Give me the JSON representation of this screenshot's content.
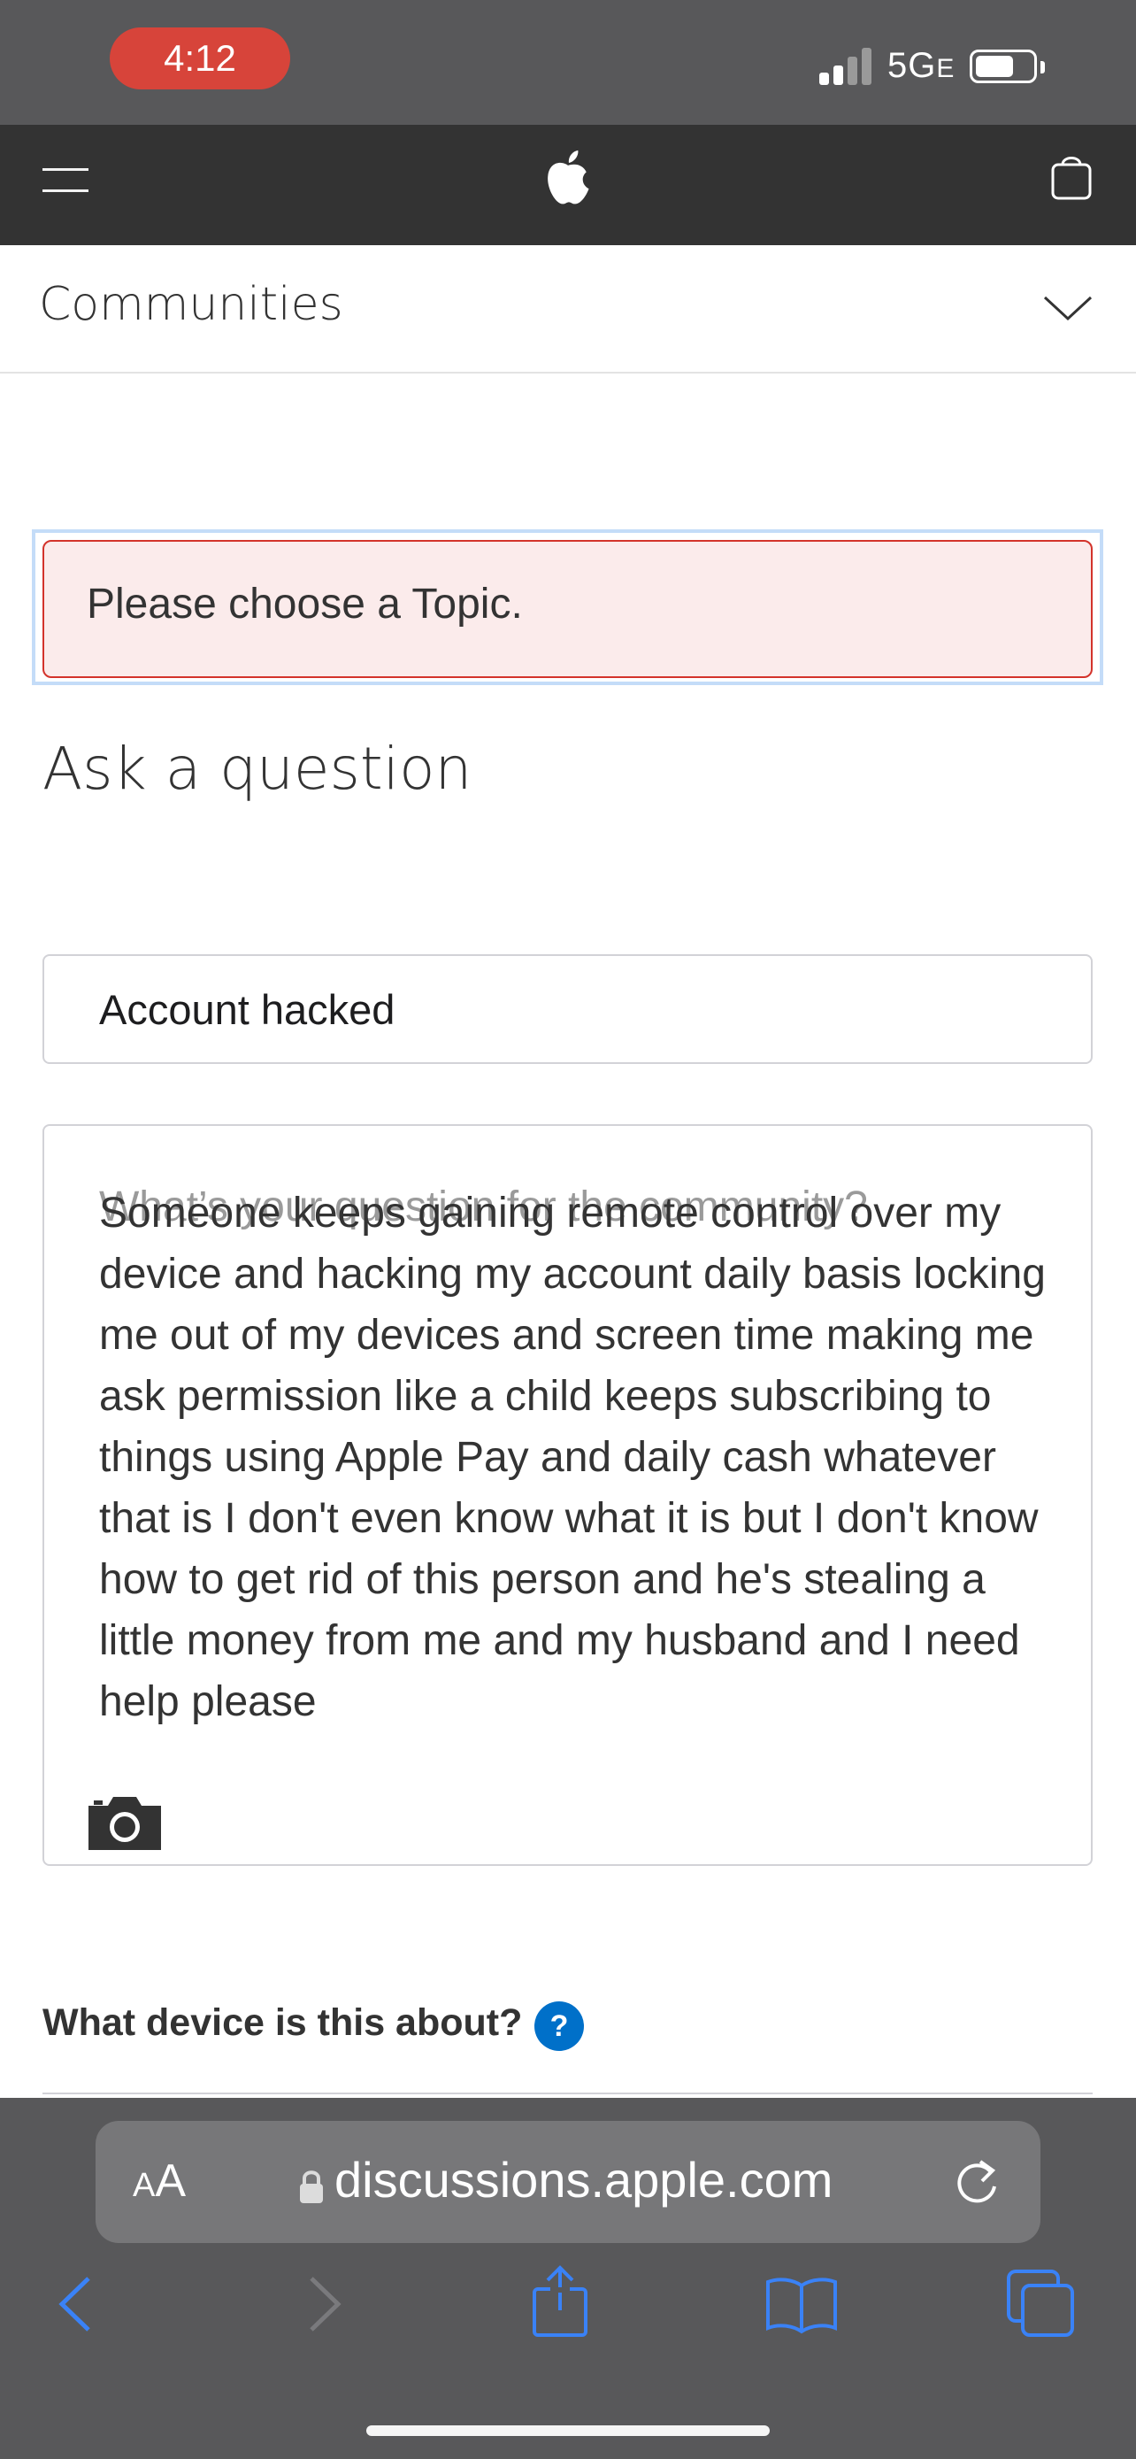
{
  "status_bar": {
    "time": "4:12",
    "network": "5G",
    "network_suffix": "E",
    "pill_color": "#d7443a"
  },
  "nav": {
    "menu_icon": "hamburger-icon",
    "logo_icon": "apple-logo-icon",
    "bag_icon": "shopping-bag-icon",
    "background": "#333333"
  },
  "communities": {
    "label": "Communities",
    "toggle_icon": "chevron-down-icon"
  },
  "error": {
    "message": "Please choose a Topic.",
    "border_color": "#d3332b"
  },
  "form": {
    "heading": "Ask a question",
    "title_value": "Account hacked",
    "body_placeholder": "What’s your question for the community?",
    "body_value": "Someone keeps gaining remote control over my device and hacking my account daily basis locking me out of my devices and screen time making me ask permission like a child keeps subscribing to things using Apple Pay and daily cash whatever that is I don't even know what it is but I don't know how to get rid of this person and he's stealing a little money from me and my husband and I need help please",
    "camera_icon": "camera-icon",
    "device_question": "What device is this about?",
    "help_label": "?"
  },
  "safari": {
    "text_size_label_small": "A",
    "text_size_label_large": "A",
    "url": "discussions.apple.com",
    "lock_icon": "lock-icon",
    "reload_icon": "reload-icon",
    "toolbar": [
      "back-icon",
      "forward-icon",
      "share-icon",
      "bookmarks-icon",
      "tabs-icon"
    ],
    "accent": "#3a82f7"
  }
}
